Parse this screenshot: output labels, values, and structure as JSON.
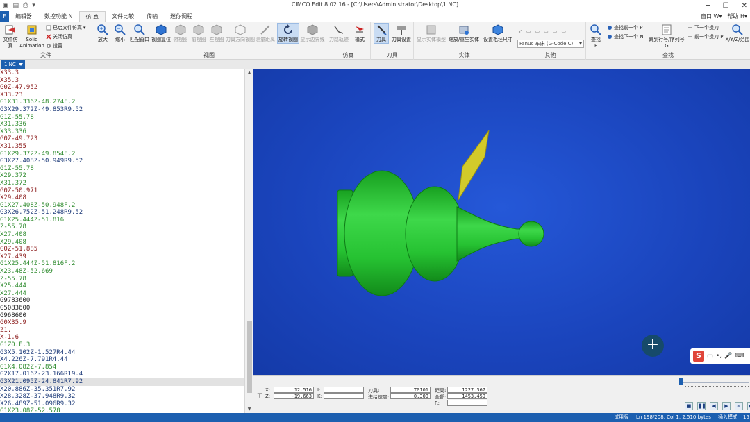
{
  "window": {
    "title": "CIMCO Edit 8.02.16 - [C:\\Users\\Administrator\\Desktop\\1.NC]",
    "min_label": "─",
    "max_label": "☐",
    "close_label": "✕"
  },
  "tabs": {
    "file": "F",
    "items": [
      "编辑器",
      "数控功能 N",
      "仿 真",
      "文件比较",
      "传输",
      "迷你调程"
    ],
    "active_index": 2,
    "right": [
      "窗口 W▾",
      "帮助 H▾"
    ]
  },
  "ribbon": {
    "groups": {
      "file": "文件",
      "view": "视图",
      "simulate": "仿真",
      "tool": "刀具",
      "solid": "实体",
      "other": "其他",
      "find": "查找"
    },
    "buttons": {
      "file_sim": "文件仿真",
      "solid_animation_line1": "Solid",
      "solid_animation_line2": "Animation",
      "close_file_sim": "已启文件仿真",
      "close_sim": "关闭仿真",
      "settings": "设置",
      "zoom_in": "放大",
      "zoom_out": "缩小",
      "fit_window": "匹配窗口",
      "view_reset": "视图复位",
      "iso_view": "俯视图",
      "front_view": "前视图",
      "side_view": "左视图",
      "tool_dir_view": "刀具方向视图",
      "measure": "测量距离",
      "rotate_view": "旋转视图",
      "show_bounds": "显示边界线",
      "tool_path": "刀路轨迹",
      "mode": "模式",
      "tool": "刀具",
      "tool_settings": "刀具设置",
      "show_solid_model": "显示实体模型",
      "scale_solid": "缩放/重生实体",
      "set_stock": "设置毛坯尺寸",
      "find": "查找",
      "find_prev": "查找前一个 P",
      "find_next": "查找下一个 N",
      "goto_line": "跳到行号/序列号",
      "prev_tool_change": "下一个换刀 T",
      "next_tool_change": "前一个换刀 P",
      "xyz_search": "X/Y/Z/范围"
    },
    "machine_combo": "Fanuc 车床 (G-Code C)"
  },
  "doc_tab": "1.NC",
  "code_lines": [
    {
      "text": "X33.3",
      "color": "#8b1a1a"
    },
    {
      "text": "X35.3",
      "color": "#8b1a1a"
    },
    {
      "text": "G0Z-47.952",
      "color": "#8b1a1a"
    },
    {
      "text": "X33.23",
      "color": "#8b1a1a"
    },
    {
      "text": "G1X31.336Z-48.274F.2",
      "color": "#2e8b2e"
    },
    {
      "text": "G3X29.372Z-49.853R9.52",
      "color": "#1f3c7a"
    },
    {
      "text": "G1Z-55.78",
      "color": "#2e8b2e"
    },
    {
      "text": "X31.336",
      "color": "#2e8b2e"
    },
    {
      "text": "X33.336",
      "color": "#2e8b2e"
    },
    {
      "text": "G0Z-49.723",
      "color": "#8b1a1a"
    },
    {
      "text": "X31.355",
      "color": "#8b1a1a"
    },
    {
      "text": "G1X29.372Z-49.854F.2",
      "color": "#2e8b2e"
    },
    {
      "text": "G3X27.408Z-50.949R9.52",
      "color": "#1f3c7a"
    },
    {
      "text": "G1Z-55.78",
      "color": "#2e8b2e"
    },
    {
      "text": "X29.372",
      "color": "#2e8b2e"
    },
    {
      "text": "X31.372",
      "color": "#2e8b2e"
    },
    {
      "text": "G0Z-50.971",
      "color": "#8b1a1a"
    },
    {
      "text": "X29.408",
      "color": "#8b1a1a"
    },
    {
      "text": "G1X27.408Z-50.948F.2",
      "color": "#2e8b2e"
    },
    {
      "text": "G3X26.752Z-51.248R9.52",
      "color": "#1f3c7a"
    },
    {
      "text": "G1X25.444Z-51.816",
      "color": "#2e8b2e"
    },
    {
      "text": "Z-55.78",
      "color": "#2e8b2e"
    },
    {
      "text": "X27.408",
      "color": "#2e8b2e"
    },
    {
      "text": "X29.408",
      "color": "#2e8b2e"
    },
    {
      "text": "G0Z-51.885",
      "color": "#8b1a1a"
    },
    {
      "text": "X27.439",
      "color": "#8b1a1a"
    },
    {
      "text": "G1X25.444Z-51.816F.2",
      "color": "#2e8b2e"
    },
    {
      "text": "X23.48Z-52.669",
      "color": "#2e8b2e"
    },
    {
      "text": "Z-55.78",
      "color": "#2e8b2e"
    },
    {
      "text": "X25.444",
      "color": "#2e8b2e"
    },
    {
      "text": "X27.444",
      "color": "#2e8b2e"
    },
    {
      "text": "G9783600",
      "color": "#222222"
    },
    {
      "text": "G5083600",
      "color": "#222222"
    },
    {
      "text": "G968600",
      "color": "#222222"
    },
    {
      "text": "G0X35.9",
      "color": "#8b1a1a"
    },
    {
      "text": "Z1.",
      "color": "#8b1a1a"
    },
    {
      "text": "X-1.6",
      "color": "#8b1a1a"
    },
    {
      "text": "G1Z0.F.3",
      "color": "#2e8b2e"
    },
    {
      "text": "G3X5.102Z-1.527R4.44",
      "color": "#1f3c7a"
    },
    {
      "text": "X4.226Z-7.791R4.44",
      "color": "#1f3c7a"
    },
    {
      "text": "G1X4.082Z-7.854",
      "color": "#2e8b2e"
    },
    {
      "text": "G2X17.016Z-23.166R19.4",
      "color": "#1f3c7a"
    },
    {
      "text": "G3X21.095Z-24.841R7.92",
      "color": "#1f3c7a"
    },
    {
      "text": "X20.886Z-35.351R7.92",
      "color": "#1f3c7a"
    },
    {
      "text": "X28.328Z-37.948R9.32",
      "color": "#1f3c7a"
    },
    {
      "text": "X26.489Z-51.096R9.32",
      "color": "#1f3c7a"
    },
    {
      "text": "G1X23.08Z-52.578",
      "color": "#2e8b2e"
    }
  ],
  "current_line_index": 42,
  "info": {
    "x_label": "X:",
    "x_value": "12.516",
    "z_label": "Z:",
    "z_value": "-19.663",
    "i_label": "I:",
    "i_value": "",
    "k_label": "K:",
    "k_value": "",
    "tool_label": "刀具:",
    "tool_value": "T0101",
    "feed_label": "进给速度:",
    "feed_value": "0.300",
    "dist_label": "距离:",
    "dist_value": "1227.367",
    "total_label": "全部:",
    "total_value": "1453.459",
    "r_label": "R:",
    "r_value": ""
  },
  "ime": {
    "logo": "S",
    "lang": "中"
  },
  "status": {
    "mode": "试用版",
    "position": "Ln 198/208, Col 1, 2.510 bytes",
    "insert": "插入模式",
    "time": "15"
  },
  "colors": {
    "viewport_bg": "#1a47c4",
    "part": "#22c030",
    "tool": "#d4cc28",
    "accent": "#1c5fb0"
  }
}
